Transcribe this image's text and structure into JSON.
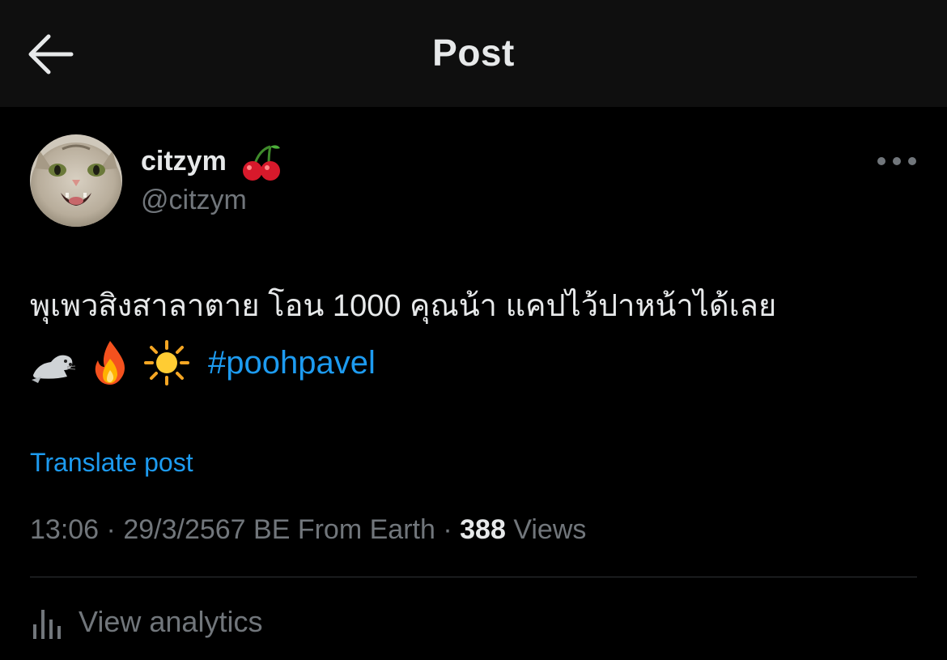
{
  "header": {
    "title": "Post",
    "back_icon": "arrow-left-icon"
  },
  "author": {
    "display_name": "citzym",
    "name_emoji": "cherries-icon",
    "handle": "@citzym",
    "avatar": "cat-avatar"
  },
  "post": {
    "text": "พุเพวสิงสาลาตาย โอน 1000 คุณน้า แคปไว้ปาหน้าได้เลย",
    "emojis": [
      "seal-icon",
      "fire-icon",
      "sun-icon"
    ],
    "hashtag": "#poohpavel",
    "translate_label": "Translate post"
  },
  "meta": {
    "time": "13:06",
    "separator": "·",
    "date": "29/3/2567 BE",
    "location": "From Earth",
    "views_count": "388",
    "views_label": "Views"
  },
  "analytics": {
    "label": "View analytics",
    "icon": "bar-chart-icon"
  },
  "colors": {
    "background": "#000000",
    "header_bg": "#0f0f0f",
    "text_primary": "#e7e9ea",
    "text_secondary": "#71767b",
    "link": "#1d9bf0",
    "divider": "#2f3336"
  }
}
